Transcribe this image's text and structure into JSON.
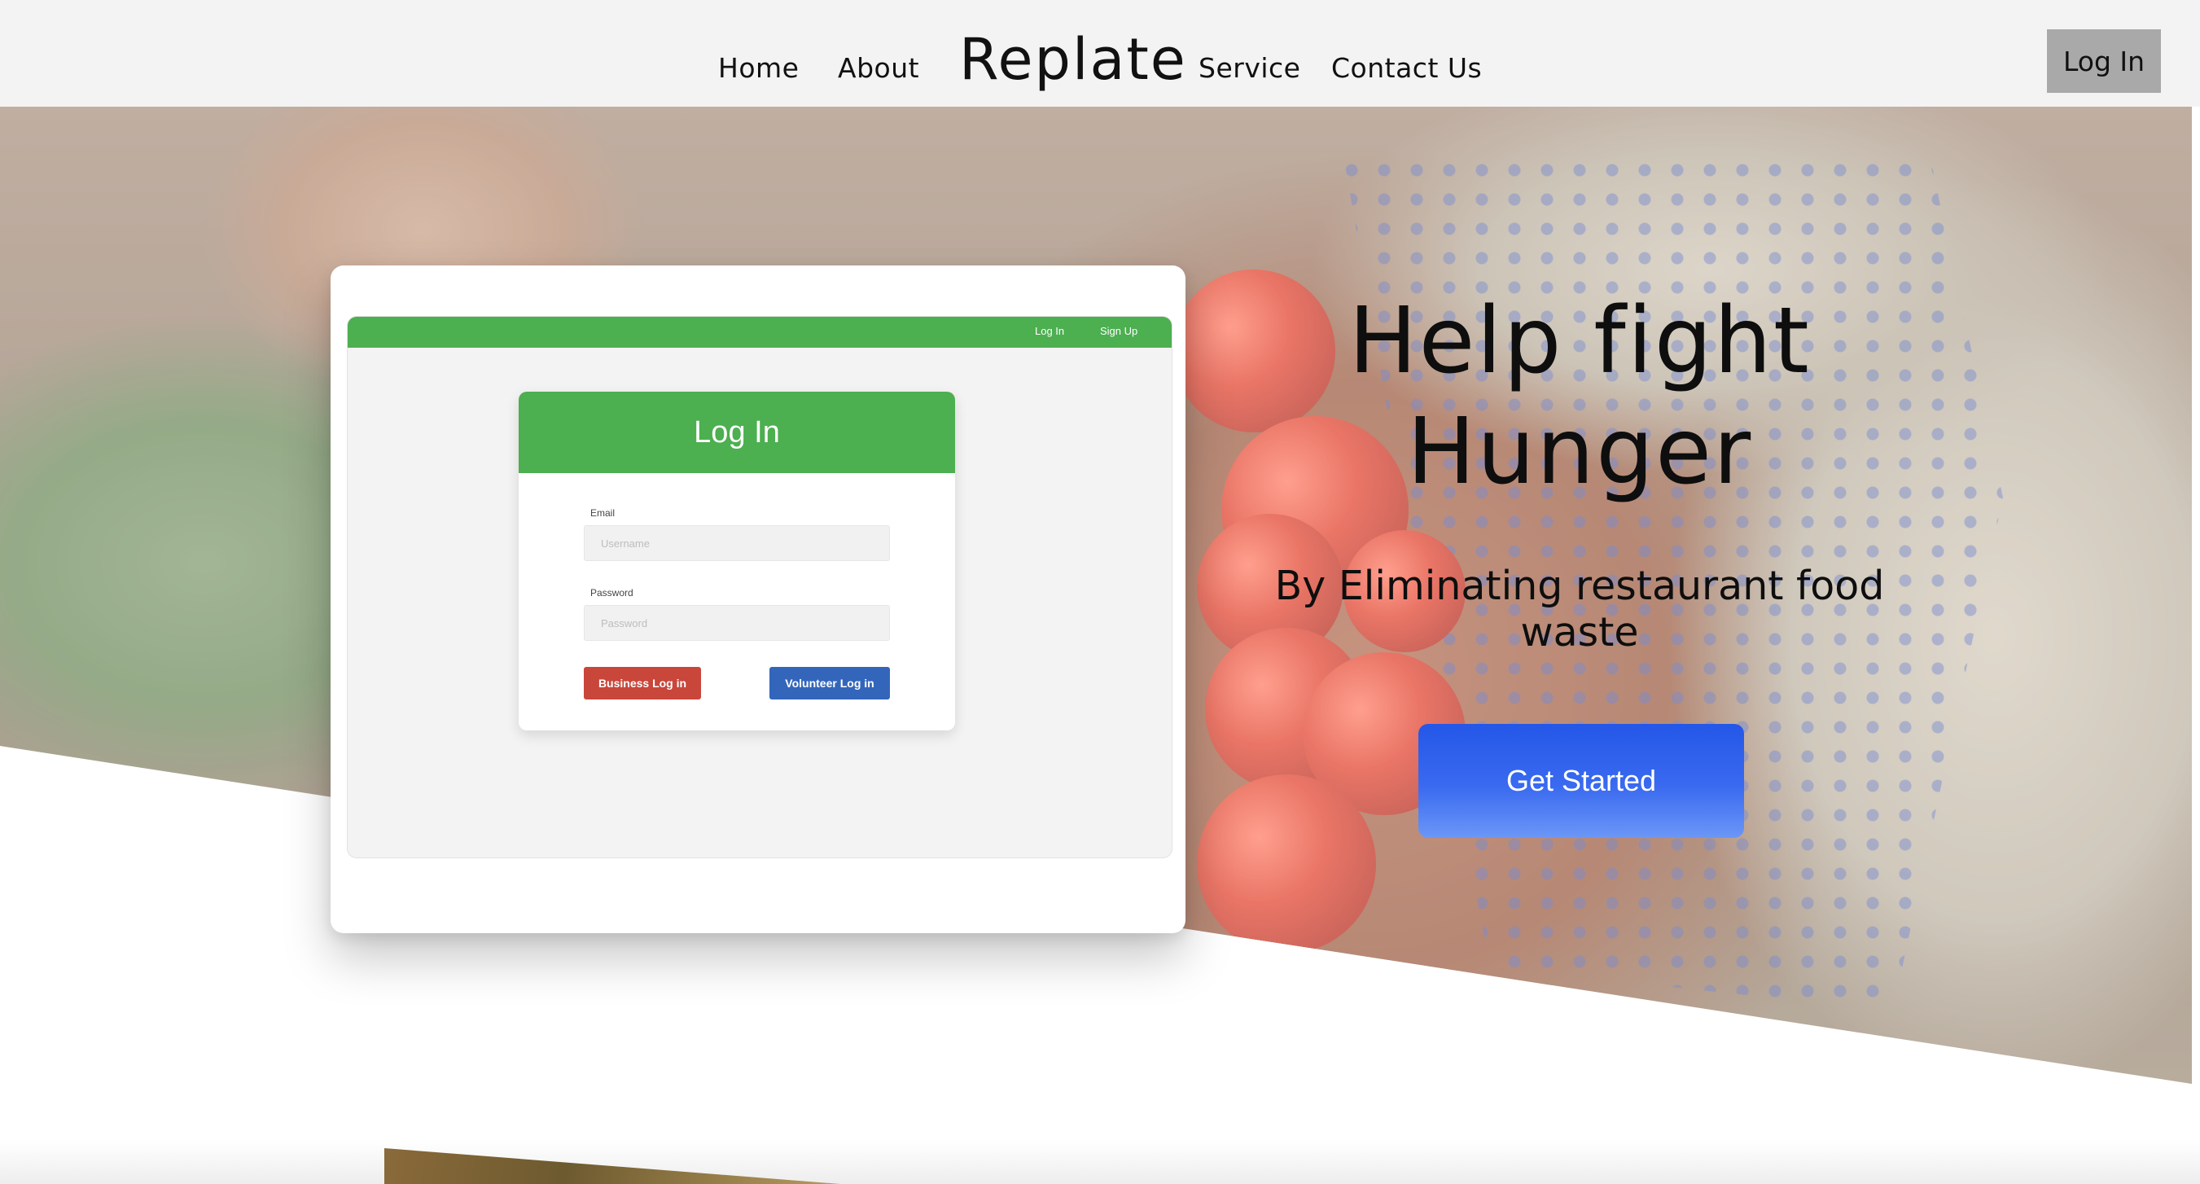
{
  "nav": {
    "links_left": [
      "Home",
      "About"
    ],
    "brand": "Replate",
    "links_right": [
      "Service",
      "Contact Us"
    ],
    "login_label": "Log In"
  },
  "hero": {
    "title": "Help fight Hunger",
    "subtitle": "By Eliminating restaurant food waste",
    "cta_label": "Get Started",
    "cta_color": "#2457e8"
  },
  "mockup": {
    "bar_links": [
      "Log In",
      "Sign Up"
    ],
    "bar_color": "#4caf50",
    "login_title": "Log In",
    "email_label": "Email",
    "email_placeholder": "Username",
    "password_label": "Password",
    "password_placeholder": "Password",
    "business_button": "Business Log in",
    "business_color": "#c9463b",
    "volunteer_button": "Volunteer Log in",
    "volunteer_color": "#3366bb"
  }
}
